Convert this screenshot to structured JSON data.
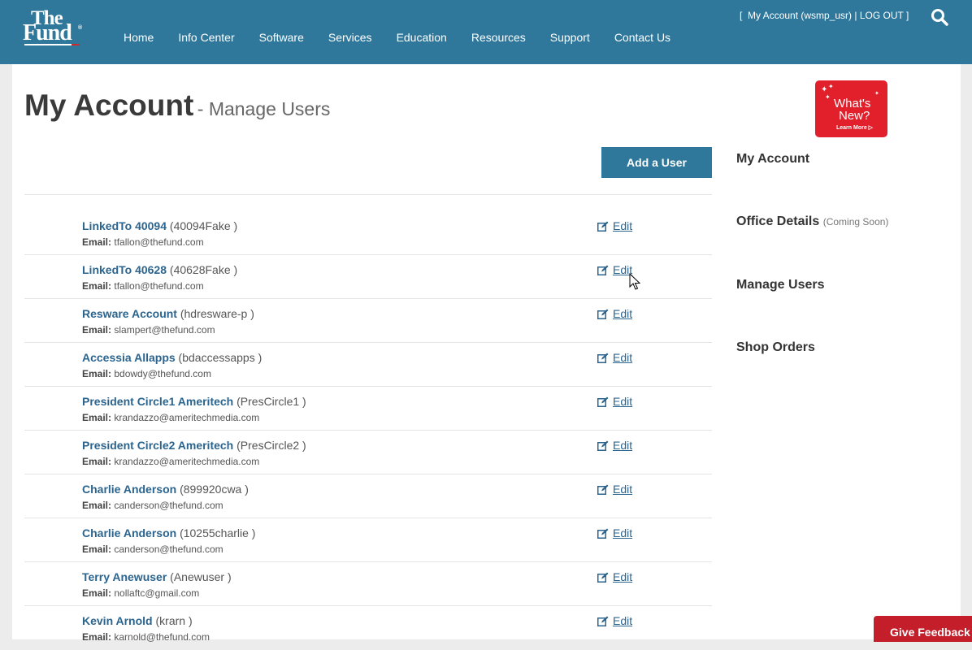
{
  "header": {
    "logo": {
      "line1": "The",
      "line2": "Fund",
      "reg": "®"
    },
    "nav": [
      "Home",
      "Info Center",
      "Software",
      "Services",
      "Education",
      "Resources",
      "Support",
      "Contact Us"
    ],
    "account_bracket_open": "[",
    "account_link": "My Account (wsmp_usr)",
    "separator": "|",
    "logout": "LOG OUT",
    "account_bracket_close": "]",
    "search_icon": "search-icon"
  },
  "page": {
    "title": "My Account",
    "subtitle": "- Manage Users",
    "add_user_label": "Add a User",
    "email_label": "Email:",
    "edit_label": "Edit"
  },
  "users": [
    {
      "name": "LinkedTo 40094",
      "username": "(40094Fake )",
      "email": "tfallon@thefund.com"
    },
    {
      "name": "LinkedTo 40628",
      "username": "(40628Fake )",
      "email": "tfallon@thefund.com"
    },
    {
      "name": "Resware Account",
      "username": "(hdresware-p )",
      "email": "slampert@thefund.com"
    },
    {
      "name": "Accessia Allapps",
      "username": "(bdaccessapps )",
      "email": "bdowdy@thefund.com"
    },
    {
      "name": "President Circle1 Ameritech",
      "username": "(PresCircle1 )",
      "email": "krandazzo@ameritechmedia.com"
    },
    {
      "name": "President Circle2 Ameritech",
      "username": "(PresCircle2 )",
      "email": "krandazzo@ameritechmedia.com"
    },
    {
      "name": "Charlie Anderson",
      "username": "(899920cwa )",
      "email": "canderson@thefund.com"
    },
    {
      "name": "Charlie Anderson",
      "username": "(10255charlie )",
      "email": "canderson@thefund.com"
    },
    {
      "name": "Terry Anewuser",
      "username": "(Anewuser )",
      "email": "nollaftc@gmail.com"
    },
    {
      "name": "Kevin Arnold",
      "username": "(krarn )",
      "email": "karnold@thefund.com"
    }
  ],
  "sidebar": {
    "promo": {
      "line1": "What's",
      "line2": "New?",
      "line3": "Learn More"
    },
    "links": [
      {
        "label": "My Account",
        "note": ""
      },
      {
        "label": "Office Details",
        "note": "(Coming Soon)"
      },
      {
        "label": "Manage Users",
        "note": ""
      },
      {
        "label": "Shop Orders",
        "note": ""
      }
    ]
  },
  "feedback_label": "Give Feedback"
}
